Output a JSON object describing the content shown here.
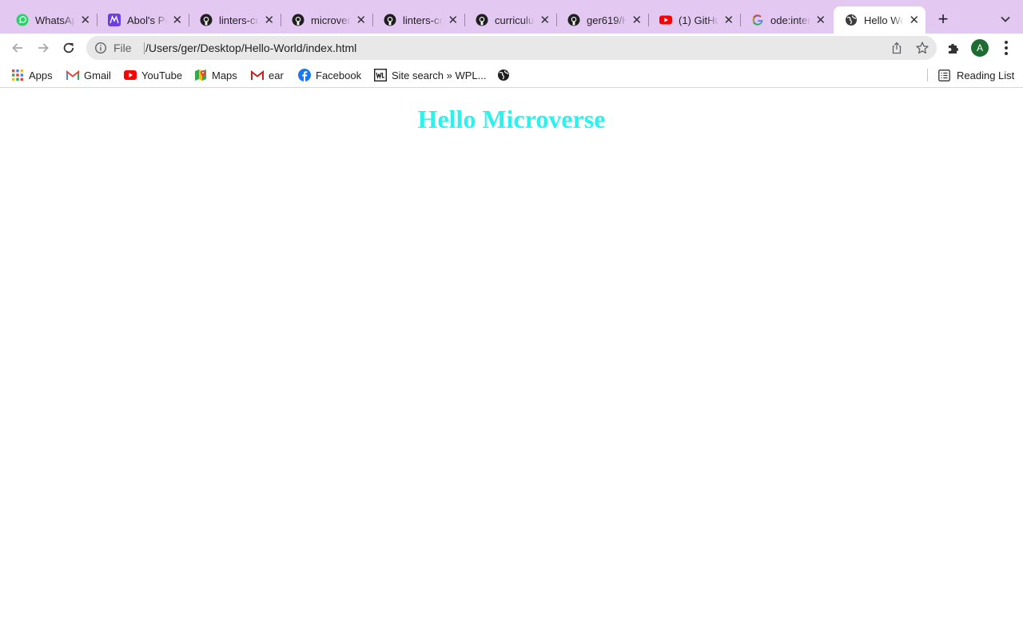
{
  "browser": {
    "tabs": [
      {
        "title": "WhatsApp",
        "icon": "whatsapp-icon"
      },
      {
        "title": "Abol's Pr",
        "icon": "abol-icon"
      },
      {
        "title": "linters-co",
        "icon": "github-icon"
      },
      {
        "title": "microverse",
        "icon": "github-icon"
      },
      {
        "title": "linters-co",
        "icon": "github-icon"
      },
      {
        "title": "curriculum",
        "icon": "github-icon"
      },
      {
        "title": "ger619/H",
        "icon": "github-icon"
      },
      {
        "title": "(1) GitHu",
        "icon": "youtube-icon"
      },
      {
        "title": "ode:inter",
        "icon": "google-icon"
      },
      {
        "title": "Hello Wo",
        "icon": "globe-icon",
        "active": true
      }
    ],
    "close_glyph": "✕",
    "new_tab_glyph": "+",
    "omnibox": {
      "scheme": "File",
      "url": "/Users/ger/Desktop/Hello-World/index.html"
    },
    "profile_initial": "A",
    "colors": {
      "tabstrip": "#e3c8f2",
      "avatar": "#1e6b33"
    }
  },
  "bookmarks": {
    "items": [
      {
        "label": "Apps",
        "icon": "apps-grid-icon"
      },
      {
        "label": "Gmail",
        "icon": "gmail-icon"
      },
      {
        "label": "YouTube",
        "icon": "youtube-icon"
      },
      {
        "label": "Maps",
        "icon": "maps-icon"
      },
      {
        "label": "ear",
        "icon": "gmail-icon"
      },
      {
        "label": "Facebook",
        "icon": "facebook-icon"
      },
      {
        "label": "Site search » WPL...",
        "icon": "wpl-icon"
      },
      {
        "label": "",
        "icon": "globe-icon"
      }
    ],
    "reading_list": "Reading List"
  },
  "page": {
    "heading": "Hello Microverse",
    "heading_color": "#2af2ec"
  }
}
